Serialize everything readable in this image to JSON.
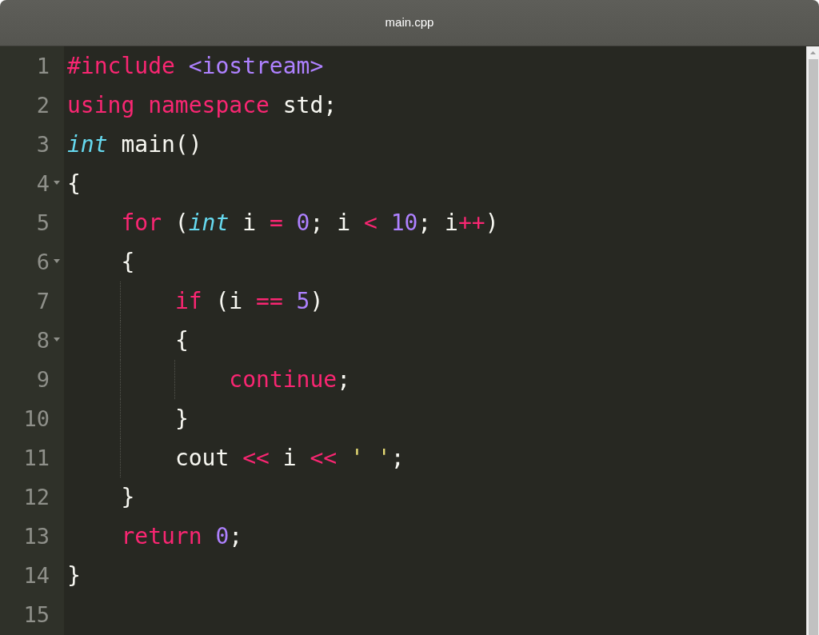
{
  "window": {
    "title": "main.cpp"
  },
  "lines": [
    {
      "number": "1",
      "foldable": false,
      "tokens": [
        {
          "kind": "keyword",
          "text": "#include "
        },
        {
          "kind": "number",
          "text": "<iostream>"
        }
      ]
    },
    {
      "number": "2",
      "foldable": false,
      "tokens": [
        {
          "kind": "keyword",
          "text": "using namespace"
        },
        {
          "kind": "plain",
          "text": " std;"
        }
      ]
    },
    {
      "number": "3",
      "foldable": false,
      "tokens": [
        {
          "kind": "type",
          "text": "int"
        },
        {
          "kind": "plain",
          "text": " main()"
        }
      ]
    },
    {
      "number": "4",
      "foldable": true,
      "tokens": [
        {
          "kind": "plain",
          "text": "{"
        }
      ],
      "children": [
        {
          "number": "5",
          "foldable": false,
          "tokens": [
            {
              "kind": "keyword",
              "text": "for"
            },
            {
              "kind": "plain",
              "text": " ("
            },
            {
              "kind": "type",
              "text": "int"
            },
            {
              "kind": "plain",
              "text": " i "
            },
            {
              "kind": "keyword",
              "text": "= "
            },
            {
              "kind": "number",
              "text": "0"
            },
            {
              "kind": "plain",
              "text": "; i "
            },
            {
              "kind": "keyword",
              "text": "< "
            },
            {
              "kind": "number",
              "text": "10"
            },
            {
              "kind": "plain",
              "text": "; i"
            },
            {
              "kind": "keyword",
              "text": "++"
            },
            {
              "kind": "plain",
              "text": ")"
            }
          ]
        },
        {
          "number": "6",
          "foldable": true,
          "tokens": [
            {
              "kind": "plain",
              "text": "{"
            }
          ],
          "children": [
            {
              "number": "7",
              "foldable": false,
              "tokens": [
                {
                  "kind": "keyword",
                  "text": "if"
                },
                {
                  "kind": "plain",
                  "text": " (i "
                },
                {
                  "kind": "keyword",
                  "text": "== "
                },
                {
                  "kind": "number",
                  "text": "5"
                },
                {
                  "kind": "plain",
                  "text": ")"
                }
              ]
            },
            {
              "number": "8",
              "foldable": true,
              "tokens": [
                {
                  "kind": "plain",
                  "text": "{"
                }
              ],
              "children": [
                {
                  "number": "9",
                  "foldable": false,
                  "tokens": [
                    {
                      "kind": "keyword",
                      "text": "continue"
                    },
                    {
                      "kind": "plain",
                      "text": ";"
                    }
                  ]
                }
              ]
            },
            {
              "number": "10",
              "foldable": false,
              "tokens": [
                {
                  "kind": "plain",
                  "text": "}"
                }
              ]
            },
            {
              "number": "11",
              "foldable": false,
              "tokens": [
                {
                  "kind": "plain",
                  "text": "cout "
                },
                {
                  "kind": "keyword",
                  "text": "<<"
                },
                {
                  "kind": "plain",
                  "text": " i "
                },
                {
                  "kind": "keyword",
                  "text": "<< "
                },
                {
                  "kind": "string",
                  "text": "' '"
                },
                {
                  "kind": "plain",
                  "text": ";"
                }
              ]
            }
          ]
        },
        {
          "number": "12",
          "foldable": false,
          "tokens": [
            {
              "kind": "plain",
              "text": "}"
            }
          ]
        },
        {
          "number": "13",
          "foldable": false,
          "tokens": [
            {
              "kind": "keyword",
              "text": "return "
            },
            {
              "kind": "number",
              "text": "0"
            },
            {
              "kind": "plain",
              "text": ";"
            }
          ]
        }
      ]
    },
    {
      "number": "14",
      "foldable": false,
      "tokens": [
        {
          "kind": "plain",
          "text": "}"
        }
      ]
    },
    {
      "number": "15",
      "foldable": false
    }
  ]
}
